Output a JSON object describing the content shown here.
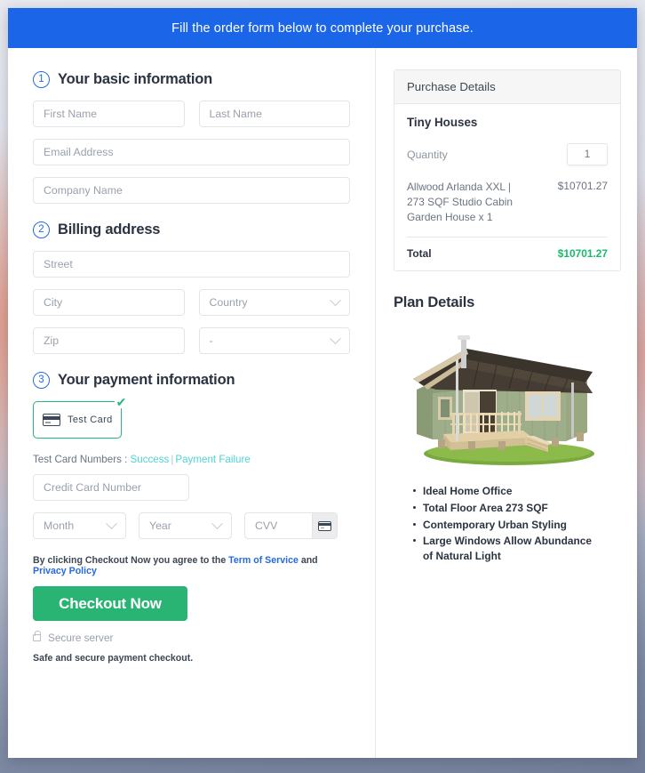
{
  "banner": {
    "message": "Fill the order form below to complete your purchase."
  },
  "steps": {
    "basic": {
      "number": "1",
      "title": "Your basic information"
    },
    "billing": {
      "number": "2",
      "title": "Billing address"
    },
    "payment": {
      "number": "3",
      "title": "Your payment information"
    }
  },
  "fields": {
    "first_name": {
      "placeholder": "First Name",
      "value": ""
    },
    "last_name": {
      "placeholder": "Last Name",
      "value": ""
    },
    "email": {
      "placeholder": "Email Address",
      "value": ""
    },
    "company": {
      "placeholder": "Company Name",
      "value": ""
    },
    "street": {
      "placeholder": "Street",
      "value": ""
    },
    "city": {
      "placeholder": "City",
      "value": ""
    },
    "country": {
      "selected": "Country"
    },
    "zip": {
      "placeholder": "Zip",
      "value": ""
    },
    "state": {
      "selected": "-"
    },
    "credit_card": {
      "placeholder": "Credit Card Number",
      "value": ""
    },
    "month": {
      "selected": "Month"
    },
    "year": {
      "selected": "Year"
    },
    "cvv": {
      "placeholder": "CVV",
      "value": ""
    }
  },
  "payment_method": {
    "tile_label": "Test Card",
    "selected": true,
    "check_glyph": "✔"
  },
  "test_card_numbers": {
    "prefix": "Test Card Numbers : ",
    "success_label": "Success",
    "separator": "|",
    "failure_label": "Payment Failure"
  },
  "terms": {
    "lead": "By clicking Checkout Now you agree to the ",
    "tos_label": "Term of Service",
    "and": " and ",
    "privacy_label": "Privacy Policy"
  },
  "checkout": {
    "button_label": "Checkout Now",
    "secure_label": "Secure server",
    "safe_note": "Safe and secure payment checkout."
  },
  "purchase": {
    "panel_title": "Purchase Details",
    "product_title": "Tiny Houses",
    "quantity_label": "Quantity",
    "quantity_value": "1",
    "line_item_desc": "Allwood Arlanda XXL | 273 SQF Studio Cabin Garden House x 1",
    "line_item_price": "$10701.27",
    "total_label": "Total",
    "total_value": "$10701.27"
  },
  "plan": {
    "title": "Plan Details",
    "features": [
      "Ideal Home Office",
      "Total Floor Area 273 SQF",
      "Contemporary Urban Styling",
      "Large Windows Allow Abundance of Natural Light"
    ]
  },
  "colors": {
    "banner_blue": "#1b66e8",
    "step_blue": "#2469e4",
    "checkout_green": "#29b473",
    "total_green": "#18b96b",
    "tile_green": "#1fb978",
    "link_teal": "#4fd3d3"
  }
}
